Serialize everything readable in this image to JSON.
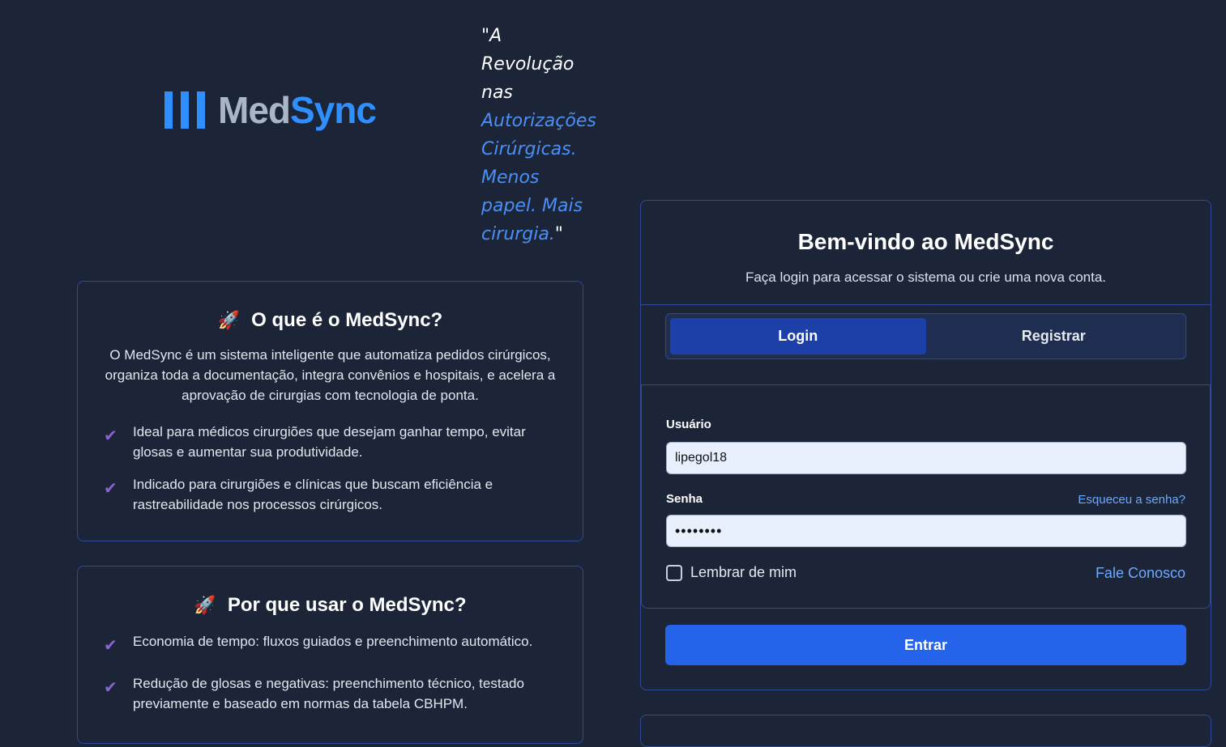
{
  "brand": {
    "logo_med": "Med",
    "logo_sync": "Sync",
    "bars_icon": "three-bars-icon"
  },
  "tagline": {
    "open": "\"A Revolução nas ",
    "highlight": "Autorizações Cirúrgicas. Menos papel. Mais cirurgia.",
    "close": "\""
  },
  "about": {
    "emoji": "🚀",
    "title": "O que é o MedSync?",
    "description": "O MedSync é um sistema inteligente que automatiza pedidos cirúrgicos, organiza toda a documentação, integra convênios e hospitais, e acelera a aprovação de cirurgias com tecnologia de ponta.",
    "items": [
      "Ideal para médicos cirurgiões que desejam ganhar tempo, evitar glosas e aumentar sua produtividade.",
      "Indicado para cirurgiões e clínicas que buscam eficiência e rastreabilidade nos processos cirúrgicos."
    ]
  },
  "why": {
    "emoji": "🚀",
    "title": "Por que usar o MedSync?",
    "items": [
      "Economia de tempo: fluxos guiados e preenchimento automático.",
      "Redução de glosas e negativas: preenchimento técnico, testado previamente e baseado em normas da tabela CBHPM."
    ]
  },
  "check_glyph": "✔",
  "login": {
    "title": "Bem-vindo ao MedSync",
    "subtitle": "Faça login para acessar o sistema ou crie uma nova conta.",
    "tabs": [
      {
        "label": "Login",
        "active": true
      },
      {
        "label": "Registrar",
        "active": false
      }
    ],
    "username_label": "Usuário",
    "username_value": "lipegol18",
    "password_label": "Senha",
    "password_value": "••••••••",
    "forgot_label": "Esqueceu a senha?",
    "remember_label": "Lembrar de mim",
    "contact_label": "Fale Conosco",
    "submit_label": "Entrar"
  },
  "colors": {
    "background": "#1b2537",
    "accent": "#2563eb",
    "brand_blue": "#2f8fff",
    "border": "#2e4a94",
    "link": "#6ea8ff",
    "check": "#8a63d2"
  }
}
